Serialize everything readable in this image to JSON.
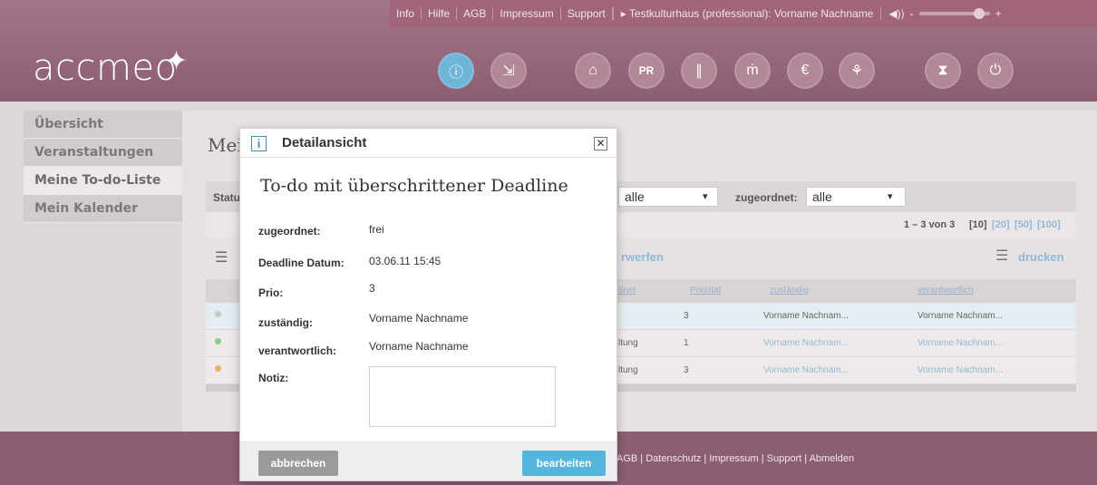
{
  "topbar": {
    "links": [
      "Info",
      "Hilfe",
      "AGB",
      "Impressum",
      "Support"
    ],
    "user": "▸ Testkulturhaus (professional): Vorname Nachname",
    "volume_icon": "◀))",
    "minus": "-",
    "plus": "+",
    "volume_level": 0.85
  },
  "logo": {
    "text": "accmeo"
  },
  "nav_icons": [
    {
      "name": "info-icon",
      "glyph": "ⓘ"
    },
    {
      "name": "arrows-icon",
      "glyph": "⇲"
    },
    {
      "name": "home-icon",
      "glyph": "⌂"
    },
    {
      "name": "pr-icon",
      "glyph": "PR"
    },
    {
      "name": "clip-icon",
      "glyph": "∥"
    },
    {
      "name": "people-icon",
      "glyph": "ṁ"
    },
    {
      "name": "euro-icon",
      "glyph": "€"
    },
    {
      "name": "brain-icon",
      "glyph": "⚘"
    },
    {
      "name": "settings-icon",
      "glyph": "⧗"
    },
    {
      "name": "power-icon",
      "glyph": "⏻"
    }
  ],
  "sidebar": {
    "items": [
      {
        "label": "Übersicht"
      },
      {
        "label": "Veranstaltungen"
      },
      {
        "label": "Meine To-do-Liste"
      },
      {
        "label": "Mein Kalender"
      }
    ]
  },
  "main": {
    "title_partial": "Mei",
    "filter": {
      "status_partial": "Statu",
      "select_value": "alle",
      "assigned_label": "zugeordnet:",
      "assigned_value": "alle"
    },
    "pager": {
      "range": "1 – 3 von 3",
      "current": "[10]",
      "other": [
        "[20]",
        "[50]",
        "[100]"
      ]
    },
    "actions": {
      "discard_partial": "rwerfen",
      "print_label": "drucken"
    },
    "columns": {
      "c1_partial": "dnet",
      "priority": "Priorität",
      "responsible": "zuständig",
      "accountable": "verantwortlich"
    },
    "rows": [
      {
        "c1": "",
        "prio": "3",
        "zust": "Vorname Nachnam...",
        "verant": "Vorname Nachnam...",
        "color": "#c9c7c7"
      },
      {
        "c1": "ltung",
        "prio": "1",
        "zust": "Vorname Nachnam...",
        "verant": "Vorname Nachnam...",
        "color": "#8cc98c"
      },
      {
        "c1": "ltung",
        "prio": "3",
        "zust": "Vorname Nachnam...",
        "verant": "Vorname Nachnam...",
        "color": "#f0b060"
      }
    ]
  },
  "footer": {
    "links": "AGB | Datenschutz | Impressum | Support | Abmelden"
  },
  "dialog": {
    "title": "Detailansicht",
    "heading": "To-do mit überschrittener Deadline",
    "fields": [
      {
        "label": "zugeordnet:",
        "value": "frei"
      },
      {
        "label": "Deadline Datum:",
        "value": "03.06.11  15:45"
      },
      {
        "label": "Prio:",
        "value": "3"
      },
      {
        "label": "zuständig:",
        "value": "Vorname  Nachname"
      },
      {
        "label": "verantwortlich:",
        "value": "Vorname  Nachname"
      }
    ],
    "notiz_label": "Notiz:",
    "notiz_value": "",
    "cancel_label": "abbrechen",
    "edit_label": "bearbeiten"
  },
  "colors": {
    "header": "#9a6e80",
    "accent": "#55b5dd",
    "overdue": "#f0b060",
    "done": "#8cc98c"
  }
}
